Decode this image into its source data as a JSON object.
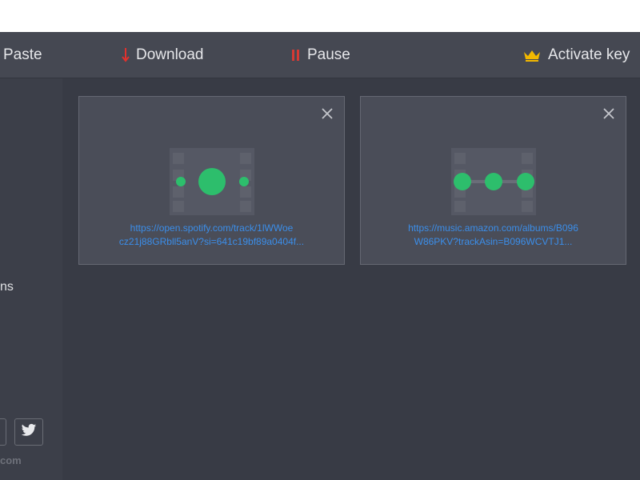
{
  "toolbar": {
    "paste_label": "Paste",
    "download_label": "Download",
    "pause_label": "Pause",
    "activate_label": "Activate key",
    "download_icon": "arrow-down-icon",
    "pause_icon": "pause-icon",
    "activate_icon": "crown-icon"
  },
  "sidebar": {
    "partial_item": "ns",
    "partial_domain": "com",
    "social": [
      "social-icon",
      "twitter-icon"
    ]
  },
  "cards": [
    {
      "url_line1": "https://open.spotify.com/track/1lWWoe",
      "url_line2": "cz21j88GRbll5anV?si=641c19bf89a0404f...",
      "thumb_icon": "audio-video-placeholder-icon"
    },
    {
      "url_line1": "https://music.amazon.com/albums/B096",
      "url_line2": "W86PKV?trackAsin=B096WCVTJ1...",
      "thumb_icon": "playlist-placeholder-icon"
    }
  ],
  "colors": {
    "accent_green": "#2dbe6c",
    "link_blue": "#3b8eea",
    "download_red": "#e2312d",
    "crown_gold": "#f2b800"
  }
}
